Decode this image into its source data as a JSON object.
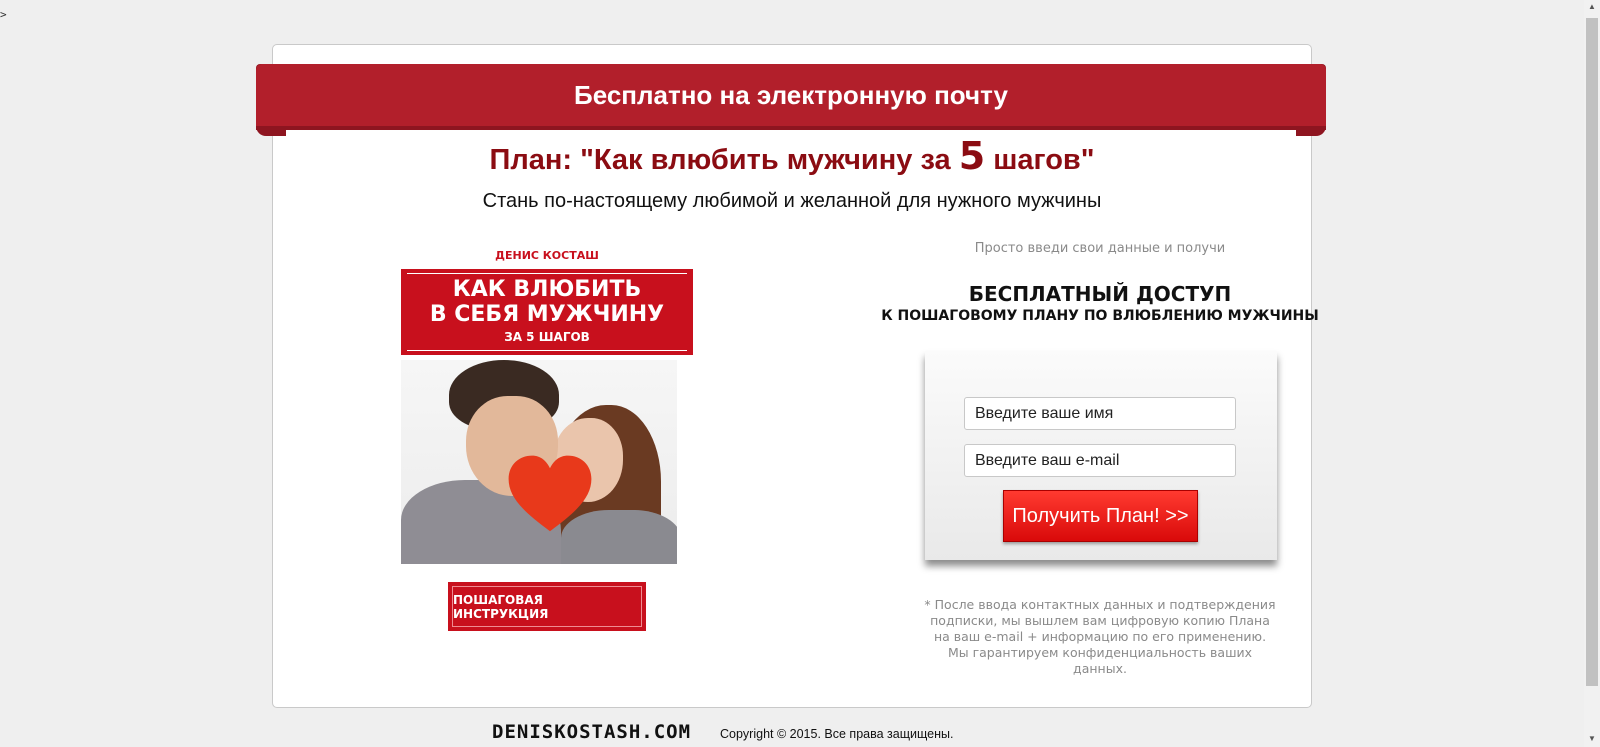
{
  "stray_glyph": ">",
  "banner": {
    "text": "Бесплатно на электронную почту",
    "color": "#b21f2b"
  },
  "headline": {
    "prefix": "План: \"Как влюбить мужчину за ",
    "number": "5",
    "suffix": " шагов\""
  },
  "subhead": "Стань по-настоящему любимой и желанной для нужного мужчины",
  "book": {
    "author": "ДЕНИС КОСТАШ",
    "title_line1": "КАК ВЛЮБИТЬ",
    "title_line2": "В СЕБЯ МУЖЧИНУ",
    "title_line3": "ЗА 5 ШАГОВ",
    "cover_image": "couple-kissing-behind-heart-image"
  },
  "instruction_button": "ПОШАГОВАЯ ИНСТРУКЦИЯ",
  "form": {
    "intro": "Просто введи свои данные и получи",
    "access_title": "БЕСПЛАТНЫЙ ДОСТУП",
    "access_subtitle": "К ПОШАГОВОМУ ПЛАНУ ПО ВЛЮБЛЕНИЮ МУЖЧИНЫ",
    "name_placeholder": "Введите ваше имя",
    "email_placeholder": "Введите ваш e-mail",
    "submit_label": "Получить План! >>",
    "disclaimer_1": "* После ввода контактных данных и подтверждения",
    "disclaimer_2": "подписки, мы вышлем вам цифровую копию Плана",
    "disclaimer_3": "на ваш e-mail + информацию по его применению.",
    "disclaimer_4": "Мы гарантируем конфиденциальность ваших данных."
  },
  "footer": {
    "logo": "DENISKOSTASH.COM",
    "copyright": "Copyright © 2015. Все права защищены."
  }
}
